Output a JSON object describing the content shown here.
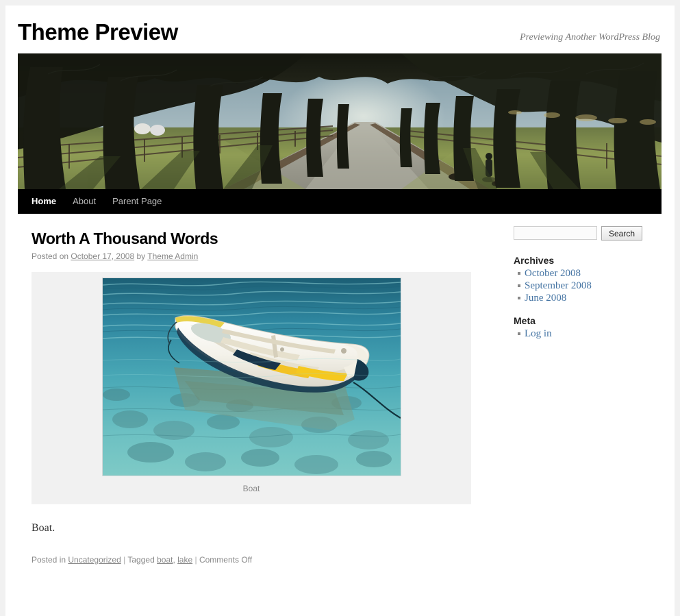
{
  "site": {
    "title": "Theme Preview",
    "description": "Previewing Another WordPress Blog"
  },
  "nav": {
    "items": [
      {
        "label": "Home",
        "current": true
      },
      {
        "label": "About",
        "current": false
      },
      {
        "label": "Parent Page",
        "current": false
      }
    ]
  },
  "header_image": {
    "alt": "Tree-lined gravel path with a lone figure walking away"
  },
  "post": {
    "title": "Worth A Thousand Words",
    "meta": {
      "posted_on_prefix": "Posted on",
      "date": "October 17, 2008",
      "by": "by",
      "author": "Theme Admin"
    },
    "figure": {
      "caption": "Boat",
      "alt": "White rowing boat with yellow seats floating on clear turquoise water"
    },
    "body": "Boat.",
    "utility": {
      "posted_in_prefix": "Posted in",
      "category": "Uncategorized",
      "sep1": "|",
      "tagged_prefix": "Tagged",
      "tags": [
        {
          "label": "boat"
        },
        {
          "label": "lake"
        }
      ],
      "tag_sep": ",",
      "sep2": "|",
      "comments": "Comments Off"
    }
  },
  "sidebar": {
    "search": {
      "value": "",
      "placeholder": "",
      "button_label": "Search"
    },
    "widgets": [
      {
        "title": "Archives",
        "items": [
          {
            "label": "October 2008"
          },
          {
            "label": "September 2008"
          },
          {
            "label": "June 2008"
          }
        ]
      },
      {
        "title": "Meta",
        "items": [
          {
            "label": "Log in"
          }
        ]
      }
    ]
  },
  "colors": {
    "page_background": "#f1f1f1",
    "content_background": "#ffffff",
    "nav_background": "#000000",
    "link_blue": "#4574a3",
    "muted_text": "#888888"
  }
}
